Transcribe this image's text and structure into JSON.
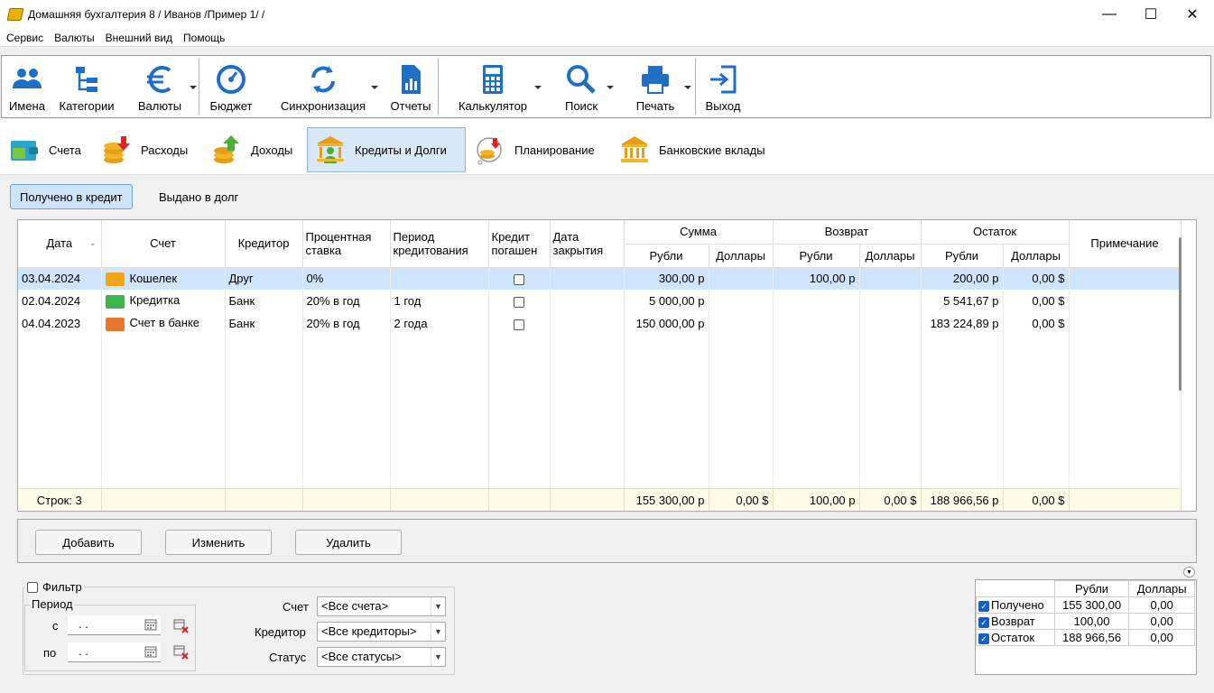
{
  "window": {
    "title": "Домашняя бухгалтерия 8  / Иванов /Пример 1/ /",
    "minimize": "—",
    "maximize": "☐",
    "close": "✕"
  },
  "menu": [
    "Сервис",
    "Валюты",
    "Внешний вид",
    "Помощь"
  ],
  "toolbar": [
    {
      "label": "Имена",
      "icon": "people-icon"
    },
    {
      "label": "Категории",
      "icon": "categories-icon"
    },
    {
      "label": "Валюты",
      "icon": "euro-icon"
    },
    {
      "label": "Бюджет",
      "icon": "gauge-icon"
    },
    {
      "label": "Синхронизация",
      "icon": "sync-icon"
    },
    {
      "label": "Отчеты",
      "icon": "report-icon"
    },
    {
      "label": "Калькулятор",
      "icon": "calculator-icon"
    },
    {
      "label": "Поиск",
      "icon": "search-icon"
    },
    {
      "label": "Печать",
      "icon": "printer-icon"
    },
    {
      "label": "Выход",
      "icon": "exit-icon"
    }
  ],
  "nav": [
    {
      "label": "Счета",
      "icon": "wallet-icon"
    },
    {
      "label": "Расходы",
      "icon": "expenses-icon"
    },
    {
      "label": "Доходы",
      "icon": "income-icon"
    },
    {
      "label": "Кредиты и Долги",
      "icon": "bank-person-icon"
    },
    {
      "label": "Планирование",
      "icon": "planning-icon"
    },
    {
      "label": "Банковские вклады",
      "icon": "bank-icon"
    }
  ],
  "subtabs": [
    "Получено в кредит",
    "Выдано в долг"
  ],
  "grid": {
    "headers": {
      "date": "Дата",
      "account": "Счет",
      "creditor": "Кредитор",
      "rate": "Процентная ставка",
      "period": "Периoд кредитования",
      "repaid": "Кредит погашен",
      "close_date": "Дата закрытия",
      "sum": "Сумма",
      "return": "Возврат",
      "balance": "Остаток",
      "rub": "Рубли",
      "usd": "Доллары",
      "note": "Примечание"
    },
    "rows": [
      {
        "date": "03.04.2024",
        "account": "Кошелек",
        "acc_color": "#f2a516",
        "creditor": "Друг",
        "rate": "0%",
        "period": "",
        "repaid": false,
        "close": "",
        "sum_rub": "300,00 р",
        "sum_usd": "",
        "ret_rub": "100,00 р",
        "ret_usd": "",
        "bal_rub": "200,00 р",
        "bal_usd": "0,00 $",
        "note": ""
      },
      {
        "date": "02.04.2024",
        "account": "Кредитка",
        "acc_color": "#3bb54a",
        "creditor": "Банк",
        "rate": "20% в год",
        "period": "1 год",
        "repaid": false,
        "close": "",
        "sum_rub": "5 000,00 р",
        "sum_usd": "",
        "ret_rub": "",
        "ret_usd": "",
        "bal_rub": "5 541,67 р",
        "bal_usd": "0,00 $",
        "note": ""
      },
      {
        "date": "04.04.2023",
        "account": "Счет в банке",
        "acc_color": "#e8772e",
        "creditor": "Банк",
        "rate": "20% в год",
        "period": "2 года",
        "repaid": false,
        "close": "",
        "sum_rub": "150 000,00 р",
        "sum_usd": "",
        "ret_rub": "",
        "ret_usd": "",
        "bal_rub": "183 224,89 р",
        "bal_usd": "0,00 $",
        "note": ""
      }
    ],
    "footer": {
      "count": "Строк: 3",
      "sum_rub": "155 300,00 р",
      "sum_usd": "0,00 $",
      "ret_rub": "100,00 р",
      "ret_usd": "0,00 $",
      "bal_rub": "188 966,56 р",
      "bal_usd": "0,00 $"
    }
  },
  "buttons": {
    "add": "Добавить",
    "edit": "Изменить",
    "delete": "Удалить"
  },
  "filter": {
    "label": "Фильтр",
    "period": "Период",
    "from": "с",
    "to": "по",
    "date_placeholder": " .  .",
    "account_label": "Счет",
    "account_value": "<Все счета>",
    "creditor_label": "Кредитор",
    "creditor_value": "<Все кредиторы>",
    "status_label": "Статус",
    "status_value": "<Все статусы>"
  },
  "summary": {
    "col_rub": "Рубли",
    "col_usd": "Доллары",
    "rows": [
      {
        "label": "Получено",
        "rub": "155 300,00",
        "usd": "0,00"
      },
      {
        "label": "Возврат",
        "rub": "100,00",
        "usd": "0,00"
      },
      {
        "label": "Остаток",
        "rub": "188 966,56",
        "usd": "0,00"
      }
    ]
  }
}
